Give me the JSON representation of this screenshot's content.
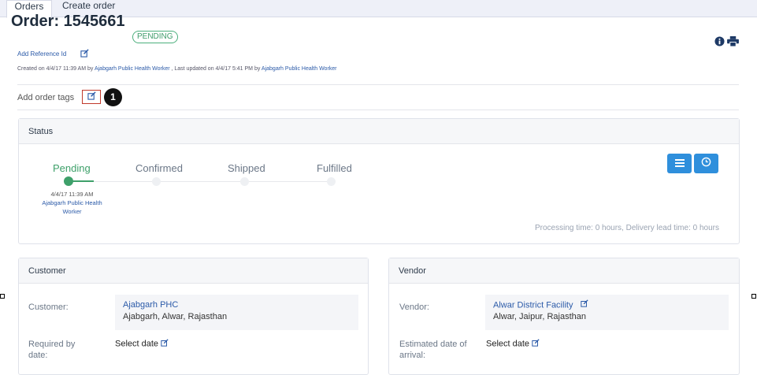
{
  "tabs": [
    {
      "label": "Orders",
      "active": true
    },
    {
      "label": "Create order",
      "active": false
    }
  ],
  "order": {
    "title": "Order: 1545661",
    "status_badge": "PENDING",
    "add_reference": "Add Reference Id",
    "meta_prefix": "Created on 4/4/17 11:39 AM by ",
    "meta_created_by": "Ajabgarh Public Health Worker",
    "meta_middle": " , Last updated on 4/4/17 5:41 PM by ",
    "meta_updated_by": "Ajabgarh Public Health Worker"
  },
  "icons": {
    "info": "info-icon",
    "print": "print-icon",
    "edit": "edit-icon"
  },
  "tags": {
    "label": "Add order tags",
    "callout": "1"
  },
  "status": {
    "heading": "Status",
    "steps": [
      "Pending",
      "Confirmed",
      "Shipped",
      "Fulfilled"
    ],
    "current_step": 0,
    "pending_time": "4/4/17 11:39 AM",
    "pending_by": "Ajabgarh Public Health Worker",
    "processing": "Processing time: 0 hours, Delivery lead time: 0 hours"
  },
  "customer": {
    "heading": "Customer",
    "label": "Customer:",
    "name": "Ajabgarh PHC",
    "address": "Ajabgarh, Alwar, Rajasthan",
    "required_label_1": "Required by",
    "required_label_2": "date:",
    "select_date": "Select date"
  },
  "vendor": {
    "heading": "Vendor",
    "label": "Vendor:",
    "name": "Alwar District Facility",
    "address": "Alwar, Jaipur, Rajasthan",
    "estimated_label_1": "Estimated date of",
    "estimated_label_2": "arrival:",
    "select_date": "Select date"
  },
  "colors": {
    "accent": "#2f8fdc",
    "success": "#3ea06a",
    "link": "#2b5aa8"
  }
}
